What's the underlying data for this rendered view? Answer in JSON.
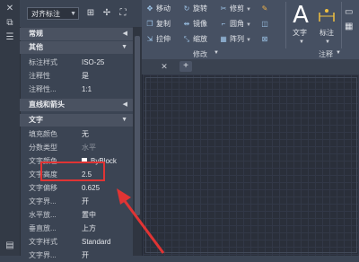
{
  "properties": {
    "selector_value": "对齐标注",
    "sections": {
      "general": "常规",
      "other": "其他",
      "lines_arrows": "直线和箭头",
      "text": "文字"
    },
    "other_rows": [
      {
        "key": "标注样式",
        "value": "ISO-25"
      },
      {
        "key": "注释性",
        "value": "是"
      },
      {
        "key": "注释性...",
        "value": "1:1"
      }
    ],
    "text_rows": [
      {
        "key": "填充颜色",
        "value": "无"
      },
      {
        "key": "分数类型",
        "value": "水平"
      },
      {
        "key": "文字颜色",
        "value": "ByBlock"
      },
      {
        "key": "文字高度",
        "value": "2.5"
      },
      {
        "key": "文字偏移",
        "value": "0.625"
      },
      {
        "key": "文字界...",
        "value": "开"
      },
      {
        "key": "水平放...",
        "value": "置中"
      },
      {
        "key": "垂直放...",
        "value": "上方"
      },
      {
        "key": "文字样式",
        "value": "Standard"
      },
      {
        "key": "文字界...",
        "value": "开"
      }
    ]
  },
  "ribbon": {
    "modify": {
      "move": "移动",
      "rotate": "旋转",
      "trim": "修剪",
      "copy": "复制",
      "mirror": "镜像",
      "fillet": "圆角",
      "stretch": "拉伸",
      "scale": "缩放",
      "array": "阵列"
    },
    "panel_title": "修改",
    "text_label": "文字",
    "dim_label": "标注",
    "annotation_title": "注释"
  },
  "colors": {
    "highlight": "#e03434",
    "arrow": "#e03434",
    "accent_icon": "#9fc6ea"
  }
}
